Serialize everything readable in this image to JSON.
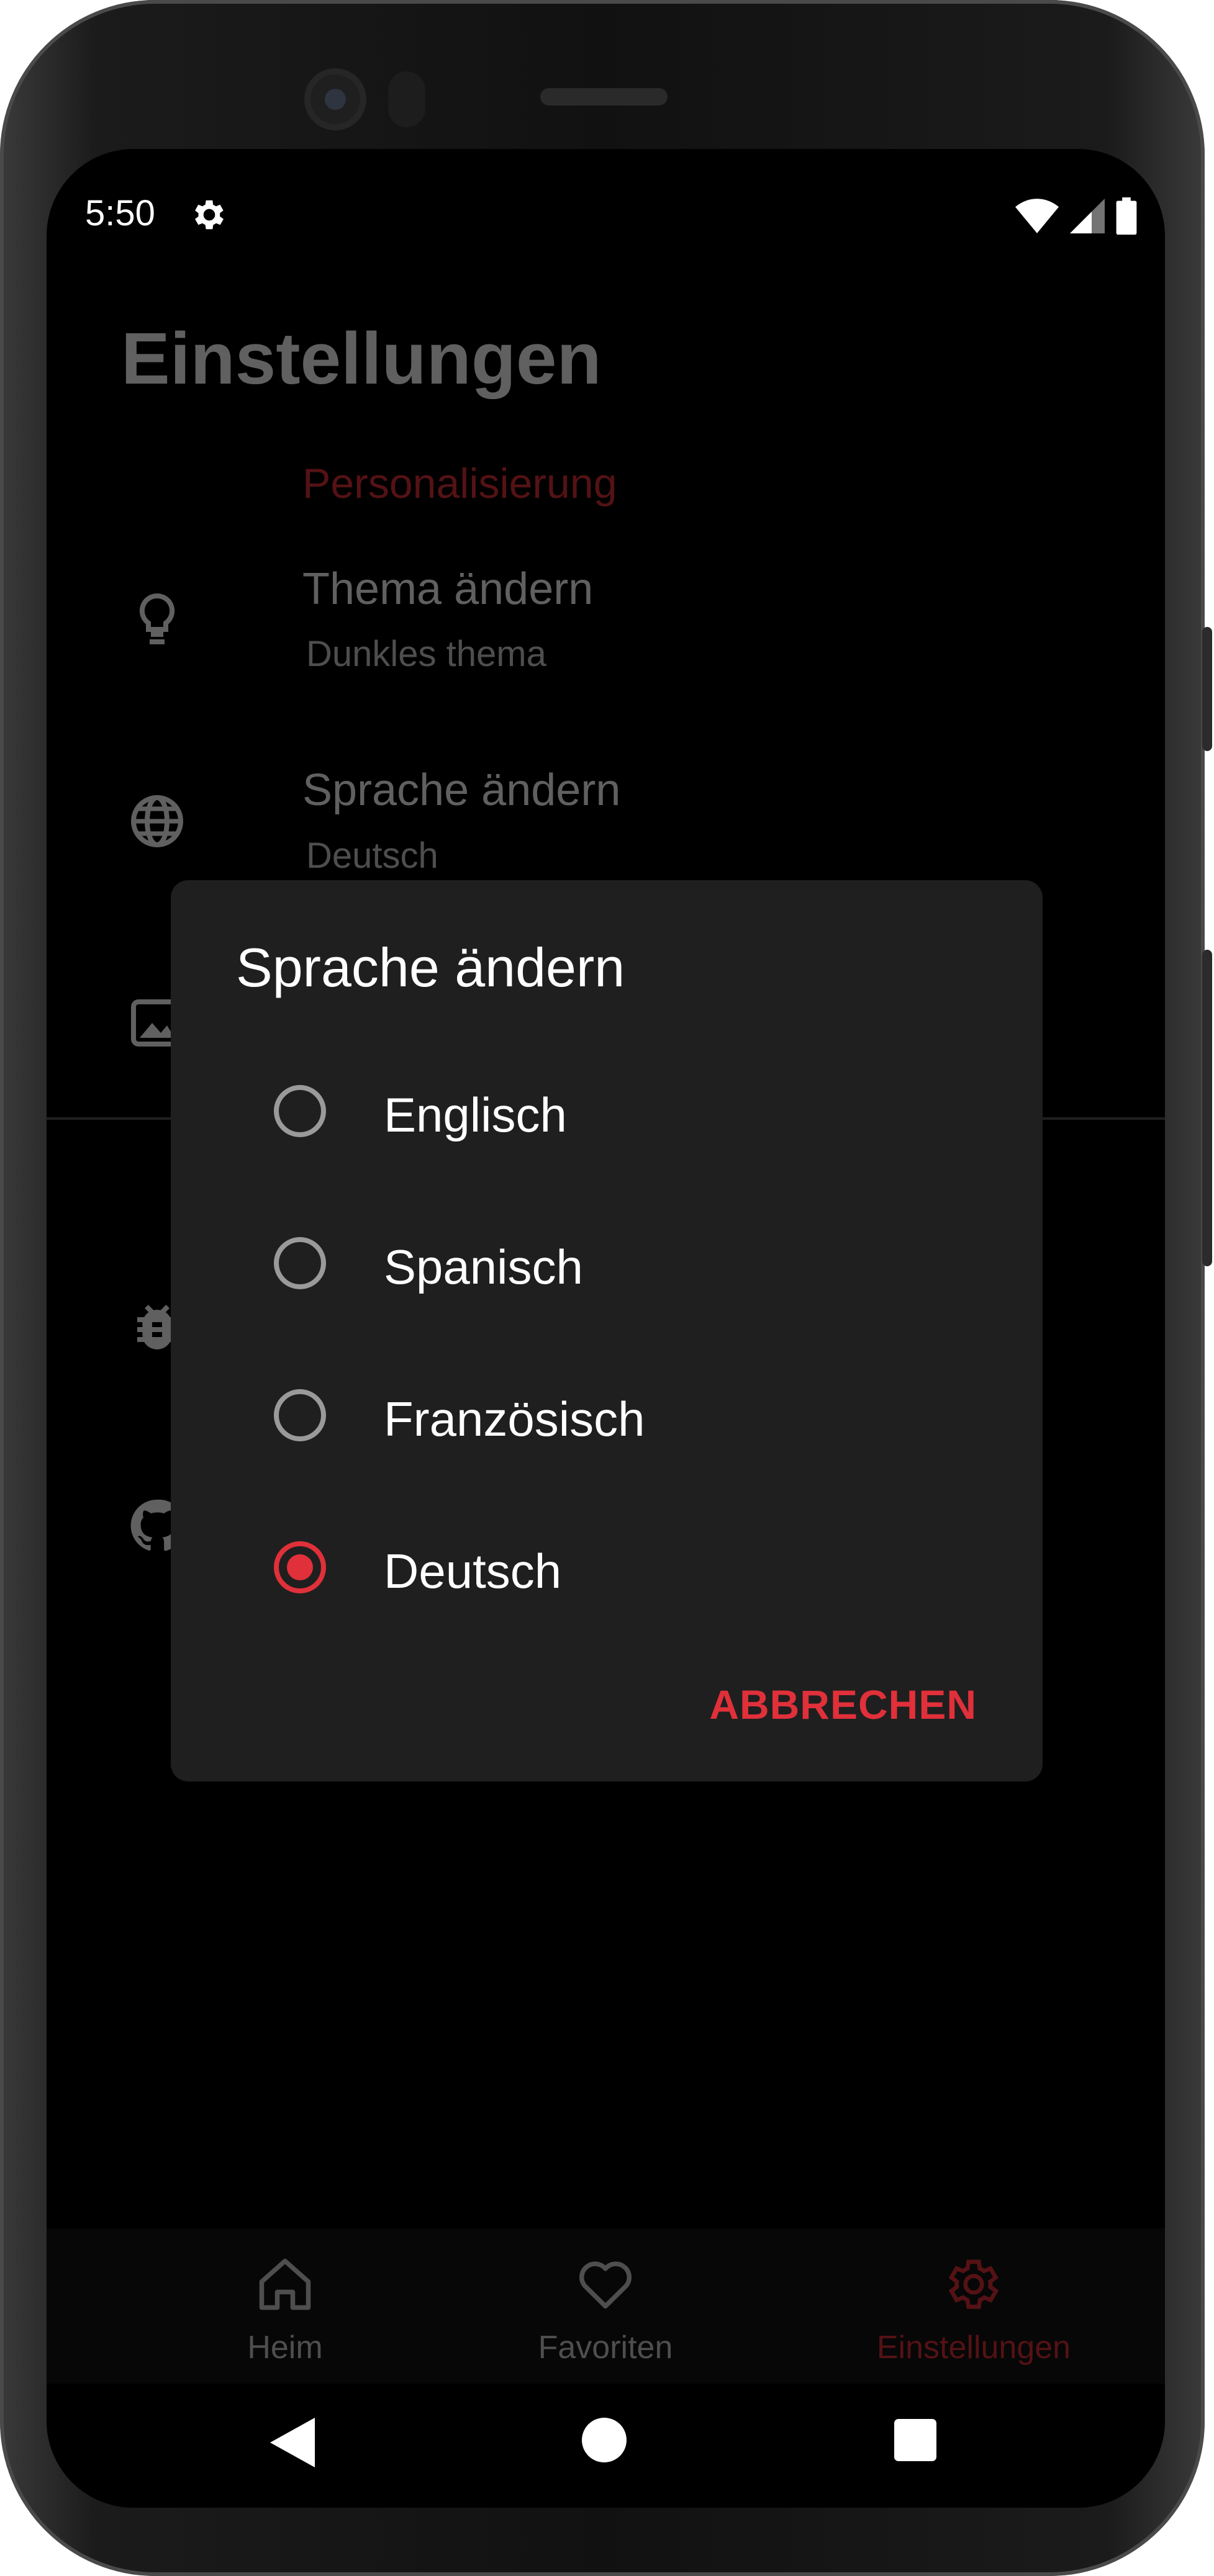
{
  "status_bar": {
    "time": "5:50"
  },
  "page": {
    "title": "Einstellungen",
    "section_label": "Personalisierung",
    "rows": [
      {
        "title": "Thema ändern",
        "subtitle": "Dunkles thema",
        "icon": "lightbulb-icon"
      },
      {
        "title": "Sprache ändern",
        "subtitle": "Deutsch",
        "icon": "globe-icon"
      }
    ]
  },
  "dialog": {
    "title": "Sprache ändern",
    "options": [
      {
        "label": "Englisch",
        "selected": false
      },
      {
        "label": "Spanisch",
        "selected": false
      },
      {
        "label": "Französisch",
        "selected": false
      },
      {
        "label": "Deutsch",
        "selected": true
      }
    ],
    "cancel_label": "ABBRECHEN"
  },
  "bottom_nav": {
    "items": [
      {
        "label": "Heim",
        "icon": "home-icon",
        "active": false
      },
      {
        "label": "Favoriten",
        "icon": "heart-icon",
        "active": false
      },
      {
        "label": "Einstellungen",
        "icon": "gear-icon",
        "active": true
      }
    ]
  },
  "colors": {
    "accent": "#e0303a",
    "dialog_bg": "#1f1f1f",
    "screen_bg": "#000000"
  }
}
